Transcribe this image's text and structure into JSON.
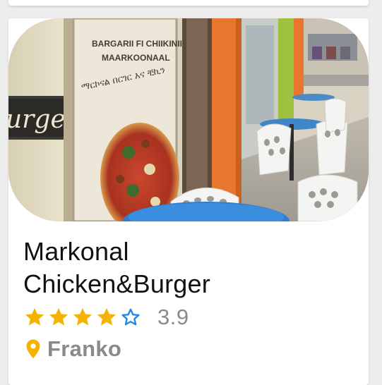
{
  "restaurant": {
    "name_line1": "Markonal",
    "name_line2": "Chicken&Burger",
    "rating_text": "3.9",
    "rating_value": 3.9,
    "stars_total": 5,
    "stars_filled": 4,
    "location": "Franko"
  },
  "photo": {
    "sign_text_line1": "BARGARII FI CHIIKINII",
    "sign_text_line2": "MAARKOONAAL",
    "sign_text_line3": "ማርኮናል በርገር እና ቺኪን",
    "side_banner_text": "urger"
  },
  "colors": {
    "star": "#f5b301",
    "text_primary": "#111111",
    "text_secondary": "#8a8a8a",
    "pin": "#f5b301"
  },
  "icons": {
    "star_filled": "star-icon",
    "star_outline": "star-outline-icon",
    "location": "location-pin-icon"
  }
}
